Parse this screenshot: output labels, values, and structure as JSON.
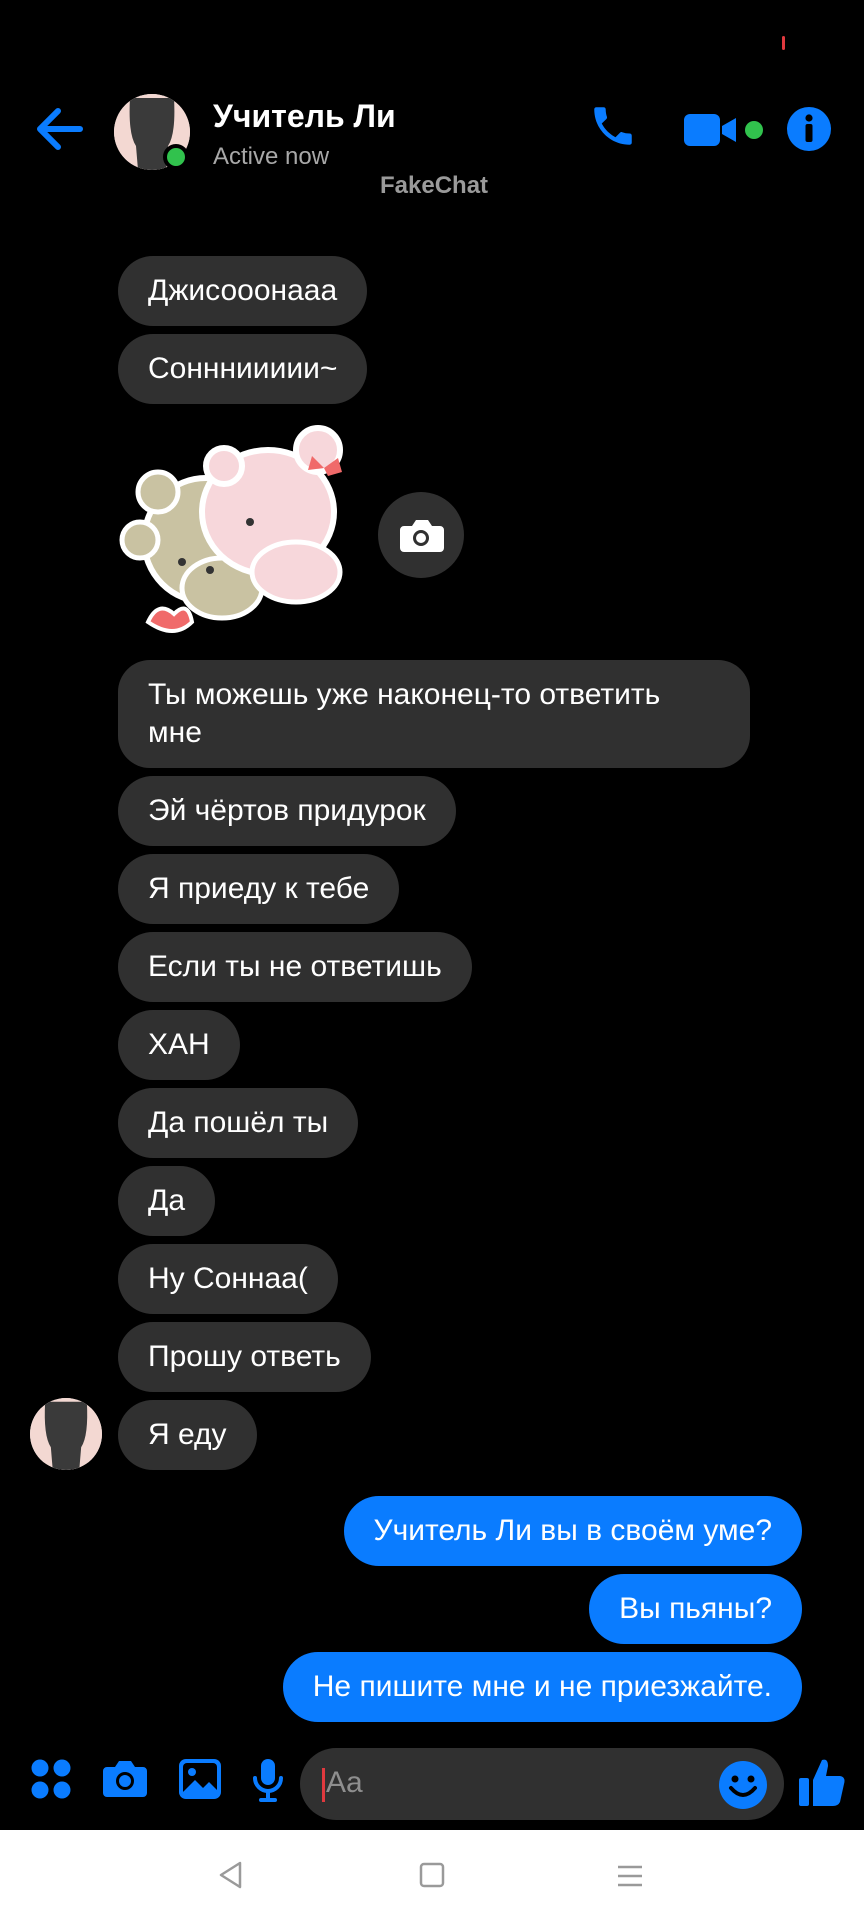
{
  "header": {
    "contact_name": "Учитель Ли",
    "contact_status": "Active now",
    "watermark": "FakeChat"
  },
  "messages": {
    "incoming": [
      "Джисооонааа",
      "Соннниииии~",
      "Ты можешь уже наконец-то ответить мне",
      "Эй чёртов придурок",
      "Я приеду к тебе",
      "Если ты не ответишь",
      "ХАН",
      "Да пошёл ты",
      "Да",
      "Ну Соннаа(",
      "Прошу ответь",
      "Я еду"
    ],
    "outgoing": [
      "Учитель Ли вы в своём уме?",
      "Вы пьяны?",
      "Не пишите мне и не приезжайте."
    ]
  },
  "composer": {
    "placeholder": "Aa"
  },
  "colors": {
    "accent": "#0a7cff",
    "incoming_bubble": "#303030",
    "online": "#31c24d",
    "background": "#000000"
  },
  "icons": [
    "back-arrow-icon",
    "phone-icon",
    "video-icon",
    "info-icon",
    "apps-icon",
    "camera-icon",
    "gallery-icon",
    "mic-icon",
    "emoji-icon",
    "thumbs-up-icon",
    "nav-back-icon",
    "nav-home-icon",
    "nav-menu-icon"
  ]
}
